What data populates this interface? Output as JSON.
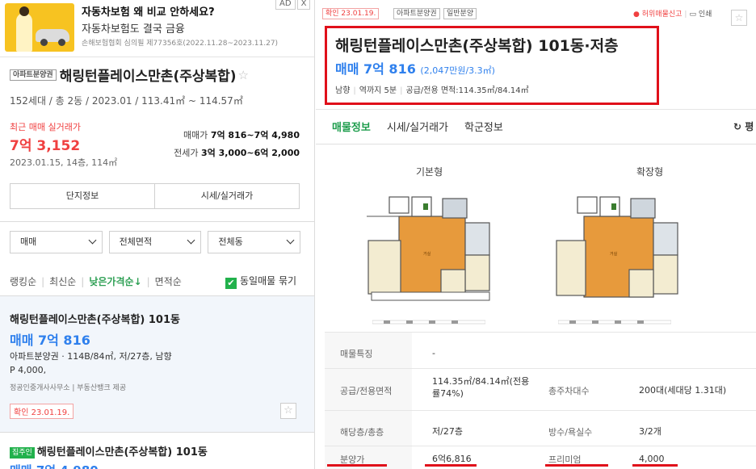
{
  "ad": {
    "title": "자동차보험 왜 비교 안하세요?",
    "subtitle": "자동차보험도 결국 금융",
    "note": "손해보험협회 심의필 제77356호(2022.11.28~2023.11.27)",
    "badge": "AD",
    "close": "X"
  },
  "complex": {
    "type_tag": "아파트분양권",
    "name": "해링턴플레이스만촌(주상복합)",
    "star": "☆",
    "meta": "152세대 / 총 2동 / 2023.01 / 113.41㎡ ~ 114.57㎡",
    "recent_label": "최근 매매 실거래가",
    "recent_price": "7억 3,152",
    "recent_date": "2023.01.15, 14층, 114㎡",
    "sale_label": "매매가",
    "sale_value": "7억 816~7억 4,980",
    "jeonse_label": "전세가",
    "jeonse_value": "3억 3,000~6억 2,000",
    "buttons": [
      "단지정보",
      "시세/실거래가"
    ]
  },
  "filters": [
    "매매",
    "전체면적",
    "전체동"
  ],
  "sort": {
    "items": [
      "랭킹순",
      "최신순",
      "낮은가격순↓",
      "면적순"
    ],
    "active_index": 2,
    "group_label": "동일매물 묶기",
    "check": "✔"
  },
  "listing1": {
    "title": "해링턴플레이스만촌(주상복합) 101동",
    "price": "매매 7억 816",
    "desc": "아파트분양권 · 114B/84㎡, 저/27층, 남향",
    "premium": "P 4,000,",
    "agent": "정공인중개사사무소 | 부동산뱅크 제공",
    "confirm": "확인 23.01.19.",
    "star": "☆"
  },
  "listing2": {
    "tag": "집주인",
    "title": "해링턴플레이스만촌(주상복합) 101동",
    "price": "매매 7억 4,980"
  },
  "detail": {
    "confirm": "확인 23.01.19.",
    "tags": [
      "아파트분양권",
      "일반분양"
    ],
    "report": "허위매물신고",
    "print": "인쇄",
    "star": "☆",
    "title": "해링턴플레이스만촌(주상복합) 101동·저층",
    "price": "매매 7억 816",
    "price_per": "(2,047만원/3.3㎡)",
    "meta": [
      "남향",
      "역까지 5분",
      "공급/전용 면적:114.35㎡/84.14㎡"
    ],
    "tabs": [
      "매물정보",
      "시세/실거래가",
      "학군정보"
    ],
    "refresh": "↻ 평",
    "floorplans": [
      "기본형",
      "확장형"
    ]
  },
  "info_table": [
    {
      "label": "매물특징",
      "value": "-"
    },
    {
      "label": "공급/전용면적",
      "value": "114.35㎡/84.14㎡(전용률74%)",
      "label2": "총주차대수",
      "value2": "200대(세대당 1.31대)"
    },
    {
      "label": "해당층/총층",
      "value": "저/27층",
      "label2": "방수/욕실수",
      "value2": "3/2개"
    },
    {
      "label": "분양가",
      "value": "6억6,816",
      "label2": "프리미엄",
      "value2": "4,000"
    }
  ],
  "colors": {
    "accent_green": "#1e9d4d",
    "price_blue": "#2f80ed",
    "highlight_red": "#e0101a",
    "recent_red": "#f04040"
  }
}
